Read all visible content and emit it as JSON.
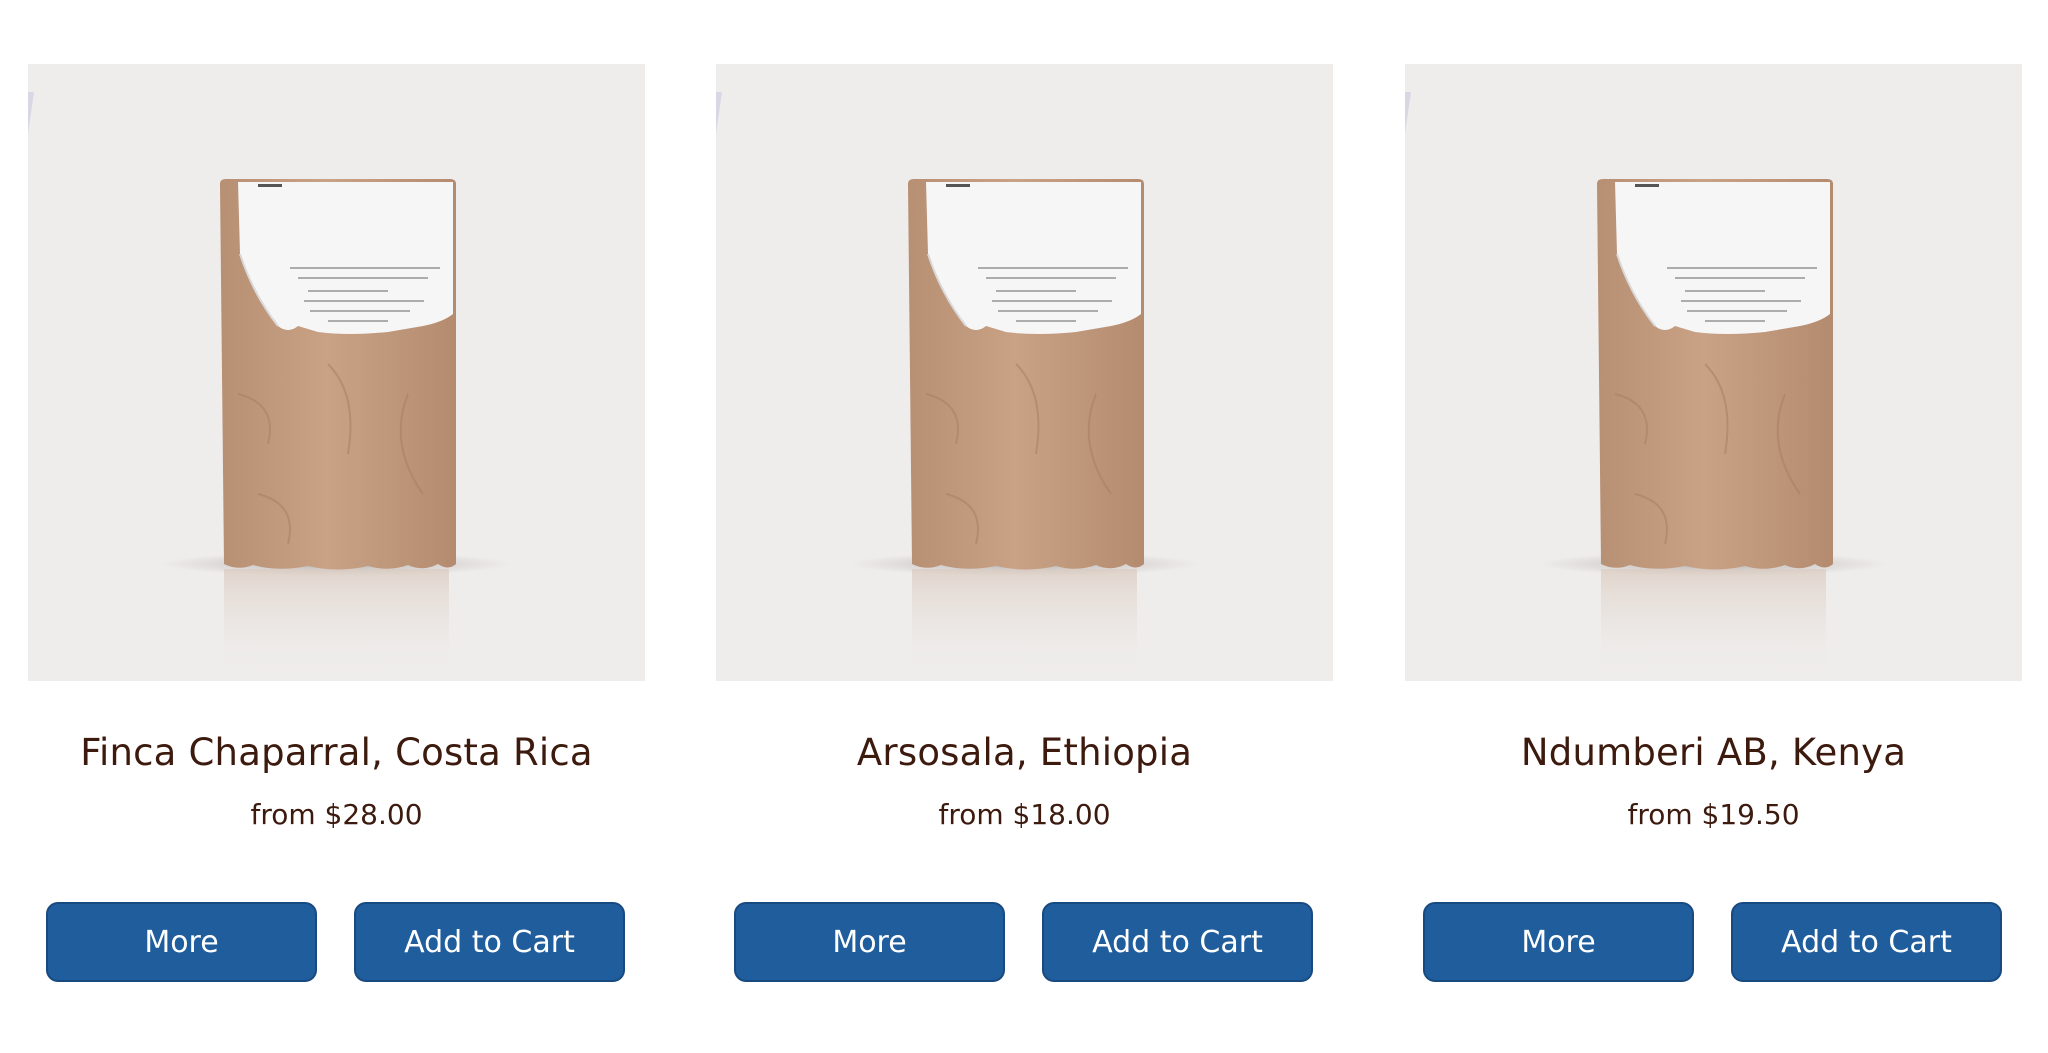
{
  "products": [
    {
      "name": "Finca Chaparral, Costa Rica",
      "price": "from $28.00",
      "more_label": "More",
      "cart_label": "Add to Cart"
    },
    {
      "name": "Arsosala, Ethiopia",
      "price": "from $18.00",
      "more_label": "More",
      "cart_label": "Add to Cart"
    },
    {
      "name": "Ndumberi AB, Kenya",
      "price": "from $19.50",
      "more_label": "More",
      "cart_label": "Add to Cart"
    }
  ],
  "colors": {
    "button_bg": "#205d9c",
    "text": "#3c1a0e",
    "image_bg": "#efedec"
  }
}
